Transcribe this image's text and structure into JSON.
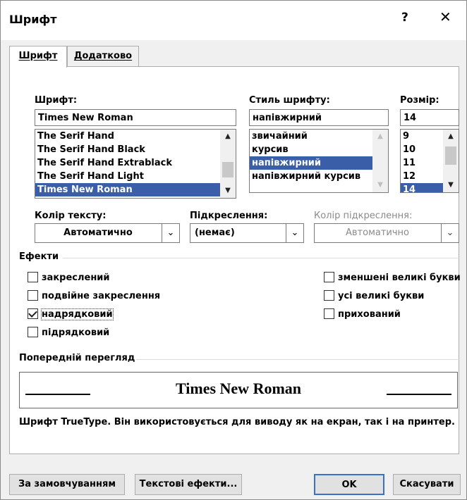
{
  "window": {
    "title": "Шрифт",
    "help": "?",
    "close": "✕"
  },
  "tabs": [
    {
      "label": "Шрифт"
    },
    {
      "label": "Додатково"
    }
  ],
  "font": {
    "label": "Шрифт:",
    "value": "Times New Roman",
    "list": [
      "The Serif Hand",
      "The Serif Hand Black",
      "The Serif Hand Extrablack",
      "The Serif Hand Light",
      "Times New Roman"
    ],
    "selected_index": 4
  },
  "style": {
    "label": "Стиль шрифту:",
    "value": "напівжирний",
    "list": [
      "звичайний",
      "курсив",
      "напівжирний",
      "напівжирний курсив"
    ],
    "selected_index": 2
  },
  "size": {
    "label": "Розмір:",
    "value": "14",
    "list": [
      "9",
      "10",
      "11",
      "12",
      "14"
    ],
    "selected_index": 4
  },
  "color": {
    "label": "Колір тексту:",
    "value": "Автоматично"
  },
  "underline": {
    "label": "Підкреслення:",
    "value": "(немає)"
  },
  "underline_color": {
    "label": "Колір підкреслення:",
    "value": "Автоматично"
  },
  "effects": {
    "title": "Ефекти",
    "left": [
      {
        "label": "закреслений",
        "checked": false
      },
      {
        "label": "подвійне закреслення",
        "checked": false
      },
      {
        "label": "надрядковий",
        "checked": true
      },
      {
        "label": "підрядковий",
        "checked": false
      }
    ],
    "right": [
      {
        "label": "зменшені великі букви",
        "checked": false
      },
      {
        "label": "усі великі букви",
        "checked": false
      },
      {
        "label": "прихований",
        "checked": false
      }
    ]
  },
  "preview": {
    "title": "Попередній перегляд",
    "text": "Times New Roman",
    "note": "Шрифт TrueType. Він використовується для виводу як на екран, так і на принтер."
  },
  "buttons": {
    "default": "За замовчуванням",
    "text_effects": "Текстові ефекти...",
    "ok": "OK",
    "cancel": "Скасувати"
  },
  "colors": {
    "selection": "#3a5ea8",
    "dialog_bg": "#f0f0f0",
    "ok_border": "#3a70c8"
  }
}
